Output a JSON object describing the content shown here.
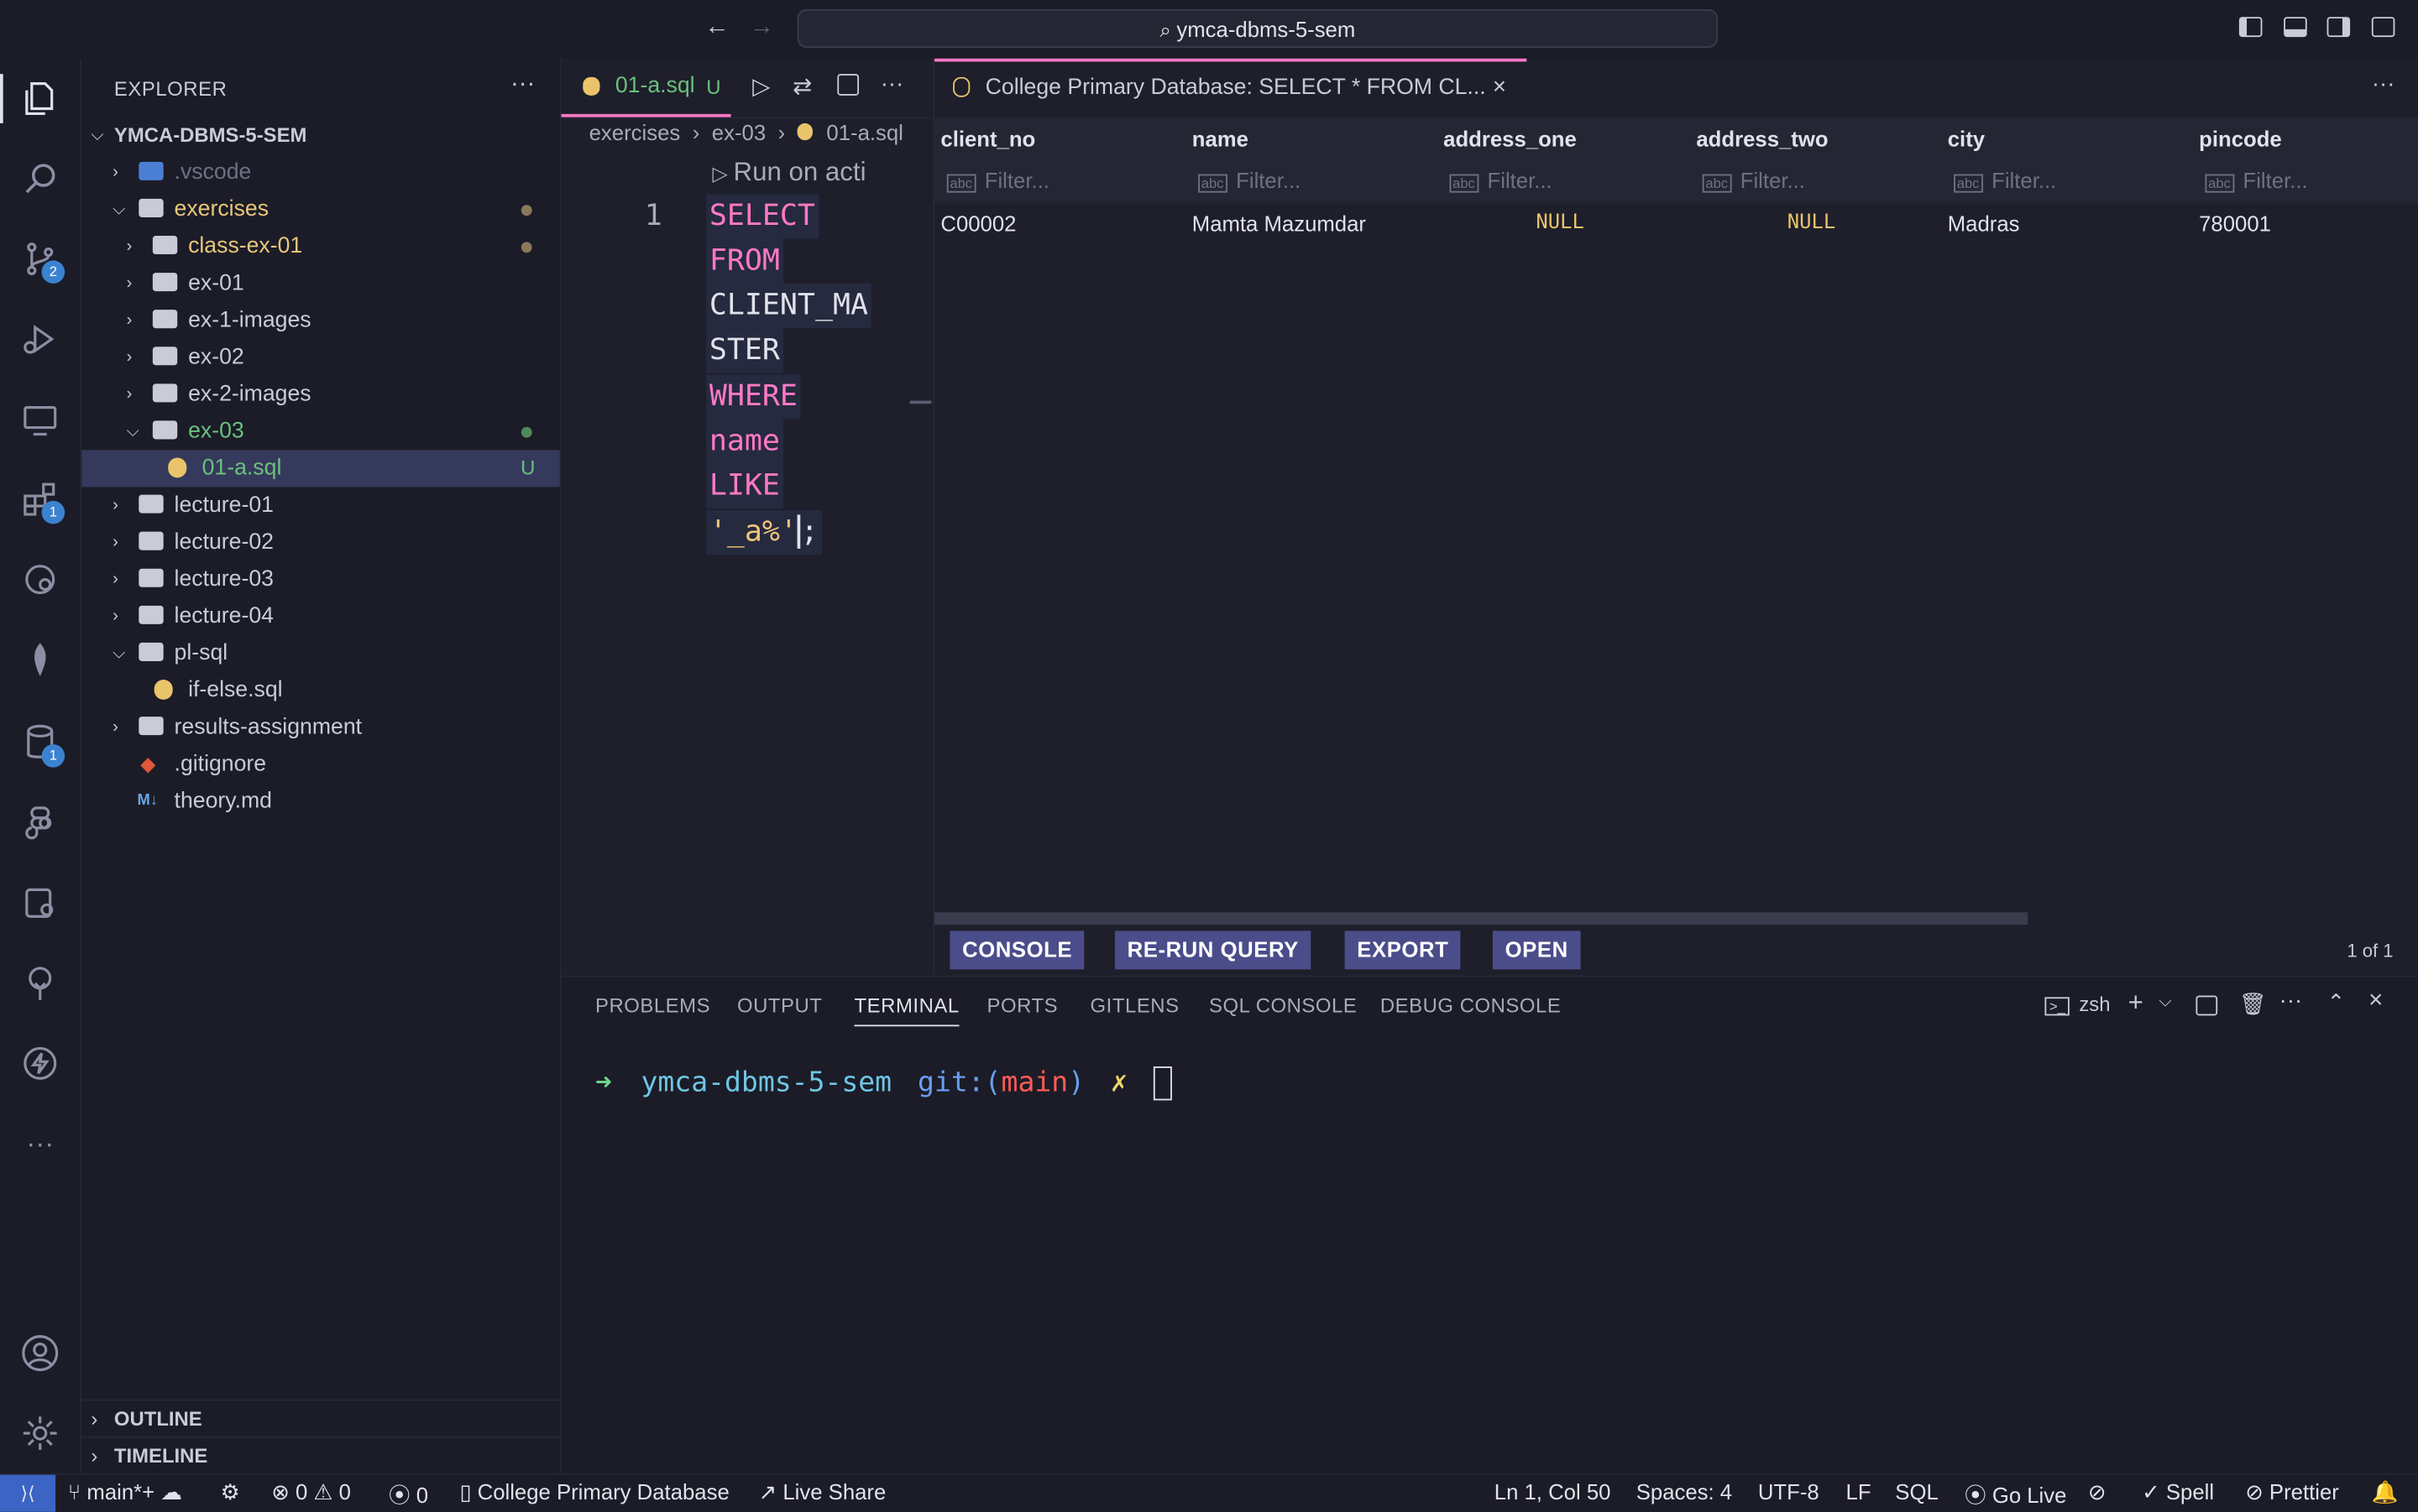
{
  "titlebar": {
    "search": "ymca-dbms-5-sem"
  },
  "activity_badges": {
    "source_control": "2",
    "extensions": "1",
    "database": "1"
  },
  "sidebar": {
    "title": "EXPLORER",
    "root": "YMCA-DBMS-5-SEM",
    "items": [
      {
        "label": ".vscode"
      },
      {
        "label": "exercises"
      },
      {
        "label": "class-ex-01"
      },
      {
        "label": "ex-01"
      },
      {
        "label": "ex-1-images"
      },
      {
        "label": "ex-02"
      },
      {
        "label": "ex-2-images"
      },
      {
        "label": "ex-03"
      },
      {
        "label": "01-a.sql",
        "badge": "U"
      },
      {
        "label": "lecture-01"
      },
      {
        "label": "lecture-02"
      },
      {
        "label": "lecture-03"
      },
      {
        "label": "lecture-04"
      },
      {
        "label": "pl-sql"
      },
      {
        "label": "if-else.sql"
      },
      {
        "label": "results-assignment"
      },
      {
        "label": ".gitignore"
      },
      {
        "label": "theory.md"
      }
    ],
    "outline": "OUTLINE",
    "timeline": "TIMELINE"
  },
  "editor": {
    "tab_label": "01-a.sql",
    "tab_badge": "U",
    "breadcrumb": [
      "exercises",
      "ex-03",
      "01-a.sql"
    ],
    "codelens": "Run on acti",
    "line_number": "1",
    "code_lines": [
      "SELECT",
      "*",
      "FROM",
      "CLIENT_MA",
      "STER",
      "WHERE",
      "name",
      "LIKE",
      "'_a%'",
      ";"
    ]
  },
  "results": {
    "tab_title": "College Primary Database: SELECT * FROM CL...",
    "columns": [
      "client_no",
      "name",
      "address_one",
      "address_two",
      "city",
      "pincode"
    ],
    "filter_placeholder": "Filter...",
    "row": [
      "C00002",
      "Mamta Mazumdar",
      "NULL",
      "NULL",
      "Madras",
      "780001"
    ],
    "buttons": [
      "CONSOLE",
      "RE-RUN QUERY",
      "EXPORT",
      "OPEN"
    ],
    "pager": "1 of 1"
  },
  "panel": {
    "tabs": [
      "PROBLEMS",
      "OUTPUT",
      "TERMINAL",
      "PORTS",
      "GITLENS",
      "SQL CONSOLE",
      "DEBUG CONSOLE"
    ],
    "shell": "zsh",
    "prompt_arrow": "➜",
    "prompt_dir": "ymca-dbms-5-sem",
    "prompt_git": "git:(",
    "prompt_branch": "main",
    "prompt_git_close": ")",
    "prompt_dirty": "✗"
  },
  "status": {
    "branch": "main*+",
    "errors": "0",
    "warnings": "0",
    "ports": "0",
    "db": "College Primary Database",
    "live_share": "Live Share",
    "cursor": "Ln 1, Col 50",
    "spaces": "Spaces: 4",
    "encoding": "UTF-8",
    "eol": "LF",
    "language": "SQL",
    "go_live": "Go Live",
    "spell": "Spell",
    "prettier": "Prettier"
  }
}
